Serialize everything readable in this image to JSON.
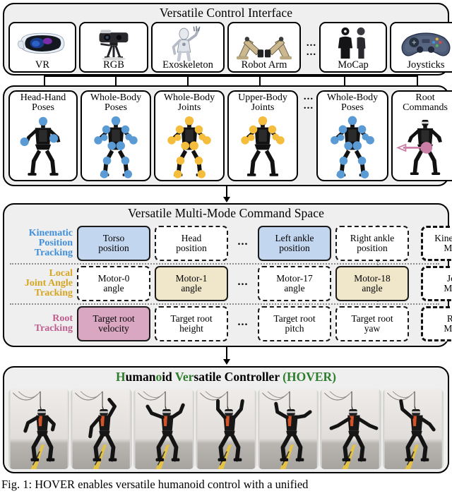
{
  "figure": {
    "caption": "Fig. 1: HOVER enables versatile humanoid control with a unified"
  },
  "devices": {
    "title": "Versatile Control Interface",
    "ellipsis": "...",
    "items": [
      {
        "label": "VR",
        "icon": "vr-headset-icon"
      },
      {
        "label": "RGB",
        "icon": "rgb-camera-icon"
      },
      {
        "label": "Exoskeleton",
        "icon": "exoskeleton-icon"
      },
      {
        "label": "Robot Arm",
        "icon": "robot-arm-icon"
      },
      {
        "label": "MoCap",
        "icon": "mocap-suit-icon"
      },
      {
        "label": "Joysticks",
        "icon": "gamepad-icon"
      }
    ]
  },
  "poses": {
    "ellipsis": "...",
    "items": [
      {
        "label": "Head-Hand\nPoses",
        "marker_color": "#5b9bd5",
        "marker_set": "head-hand"
      },
      {
        "label": "Whole-Body\nPoses",
        "marker_color": "#5b9bd5",
        "marker_set": "whole-body"
      },
      {
        "label": "Whole-Body\nJoints",
        "marker_color": "#f5bd3c",
        "marker_set": "whole-body"
      },
      {
        "label": "Upper-Body\nJoints",
        "marker_color": "#f5bd3c",
        "marker_set": "upper-body"
      },
      {
        "label": "Whole-Body\nPoses",
        "marker_color": "#5b9bd5",
        "marker_set": "whole-body"
      },
      {
        "label": "Root\nCommands",
        "marker_color": "#cc7fa6",
        "marker_set": "root"
      }
    ]
  },
  "command_space": {
    "title": "Versatile Multi-Mode Command Space",
    "ellipsis": "...",
    "rows": [
      {
        "label": "Kinematic\nPosition\nTracking",
        "label_color": "#3f8fdb",
        "fill": "#c3d6ef",
        "chips": [
          {
            "text": "Torso\nposition",
            "selected": true
          },
          {
            "text": "Head\nposition",
            "selected": false
          },
          {
            "text": "Left ankle\nposition",
            "selected": true
          },
          {
            "text": "Right ankle\nposition",
            "selected": false
          }
        ],
        "mask": "Kinematics\nMasks"
      },
      {
        "label": "Local\nJoint Angle\nTracking",
        "label_color": "#d6a520",
        "fill": "#f0e7cb",
        "chips": [
          {
            "text": "Motor-0\nangle",
            "selected": false
          },
          {
            "text": "Motor-1\nangle",
            "selected": true
          },
          {
            "text": "Motor-17\nangle",
            "selected": false
          },
          {
            "text": "Motor-18\nangle",
            "selected": true
          }
        ],
        "mask": "Joint\nMasks"
      },
      {
        "label": "Root\nTracking",
        "label_color": "#bf5d8e",
        "fill": "#d9a7c2",
        "chips": [
          {
            "text": "Target root\nvelocity",
            "selected": true
          },
          {
            "text": "Target root\nheight",
            "selected": false
          },
          {
            "text": "Target root\npitch",
            "selected": false
          },
          {
            "text": "Target root\nyaw",
            "selected": false
          }
        ],
        "mask": "Root\nMasks"
      }
    ]
  },
  "hover": {
    "title_parts": [
      {
        "text": "H",
        "highlight": true
      },
      {
        "text": "uman",
        "highlight": false
      },
      {
        "text": "o",
        "highlight": true
      },
      {
        "text": "id ",
        "highlight": false
      },
      {
        "text": "Ver",
        "highlight": true
      },
      {
        "text": "satile Controller ",
        "highlight": false
      },
      {
        "text": "(HOVER)",
        "highlight": true
      }
    ],
    "title_plain": "Humanoid Versatile Controller (HOVER)",
    "highlight_color": "#2e7d2e",
    "photo_count": 7,
    "photo_alt": "humanoid-robot-motion-frame"
  }
}
